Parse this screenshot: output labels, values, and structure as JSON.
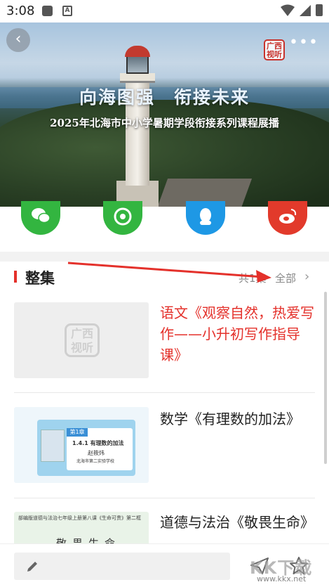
{
  "status_bar": {
    "time": "3:08",
    "a_icon": "A"
  },
  "video": {
    "headline": "向海图强　衔接未来",
    "subtitle": "2025年北海市中小学暑期学段衔接系列课程展播",
    "seal_text": "广西视听"
  },
  "share": [
    "wechat-icon",
    "moments-icon",
    "qq-icon",
    "weibo-icon"
  ],
  "collection": {
    "title": "整集",
    "count_text": "共1集",
    "all_label": "全部",
    "items": [
      {
        "title": "语文《观察自然，热爱写作——小升初写作指导课》",
        "active": true,
        "thumb_logo": "广西视听"
      },
      {
        "title": "数学《有理数的加法》",
        "active": false,
        "thumb": {
          "tag": "第1章",
          "heading": "1.4.1  有理数的加法",
          "teacher": "赵筱炜",
          "school": "北海市第二实验学校"
        }
      },
      {
        "title": "道德与法治《敬畏生命》",
        "active": false,
        "thumb": {
          "top": "部编版道德与法治七年级上册第八课《生命可贵》第二框",
          "heading": "敬畏生命"
        }
      }
    ]
  },
  "bottom_bar": {
    "comment_icon": "pencil-icon",
    "send_icon": "send-icon",
    "favorite_icon": "star-icon"
  },
  "watermark": {
    "text": "KK下载",
    "url": "www.kkx.net"
  },
  "colors": {
    "accent": "#e4312b",
    "wechat": "#33b540",
    "qq": "#1e98e5",
    "weibo": "#e23a2b"
  }
}
